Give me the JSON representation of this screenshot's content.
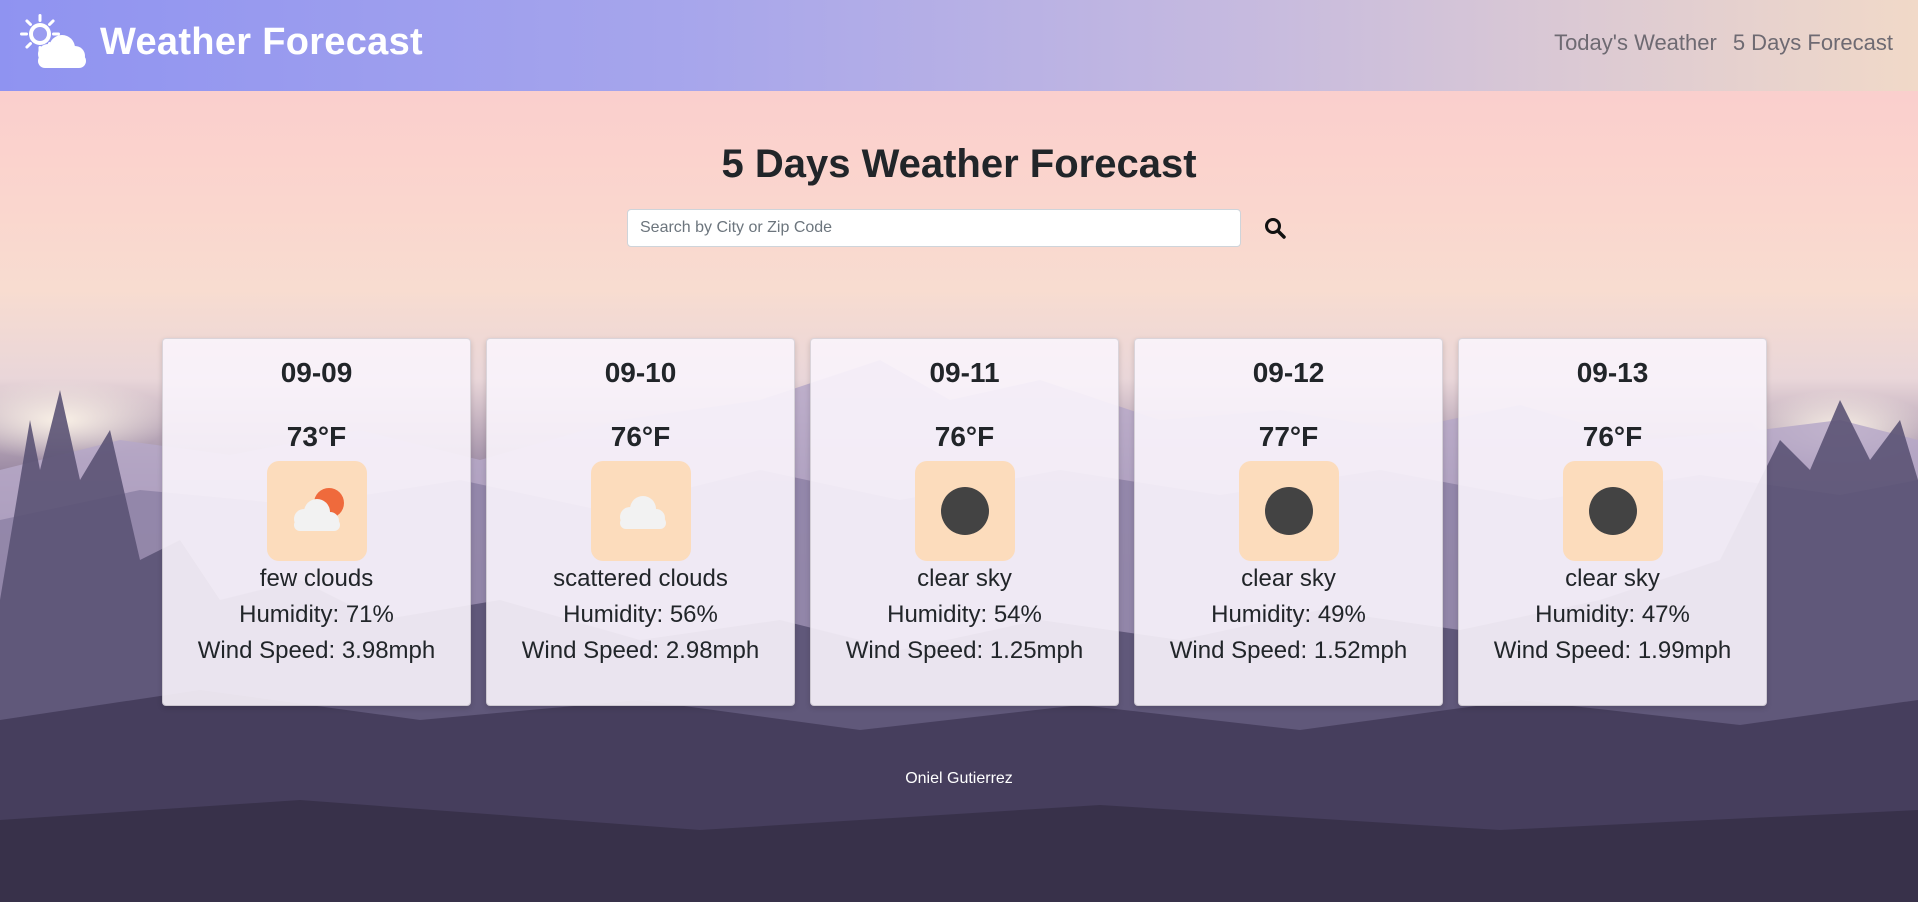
{
  "header": {
    "brand_title": "Weather Forecast",
    "brand_icon": "sun-cloud-icon",
    "nav": [
      {
        "label": "Today's Weather"
      },
      {
        "label": "5 Days Forecast"
      }
    ]
  },
  "main": {
    "title": "5 Days Weather Forecast",
    "search": {
      "placeholder": "Search by City or Zip Code",
      "value": "",
      "button_icon": "search-icon"
    },
    "forecast": [
      {
        "date": "09-09",
        "temp": "73°F",
        "icon": "few-clouds-icon",
        "description": "few clouds",
        "humidity": "Humidity: 71%",
        "wind": "Wind Speed: 3.98mph"
      },
      {
        "date": "09-10",
        "temp": "76°F",
        "icon": "scattered-clouds-icon",
        "description": "scattered clouds",
        "humidity": "Humidity: 56%",
        "wind": "Wind Speed: 2.98mph"
      },
      {
        "date": "09-11",
        "temp": "76°F",
        "icon": "clear-sky-icon",
        "description": "clear sky",
        "humidity": "Humidity: 54%",
        "wind": "Wind Speed: 1.25mph"
      },
      {
        "date": "09-12",
        "temp": "77°F",
        "icon": "clear-sky-icon",
        "description": "clear sky",
        "humidity": "Humidity: 49%",
        "wind": "Wind Speed: 1.52mph"
      },
      {
        "date": "09-13",
        "temp": "76°F",
        "icon": "clear-sky-icon",
        "description": "clear sky",
        "humidity": "Humidity: 47%",
        "wind": "Wind Speed: 1.99mph"
      }
    ]
  },
  "footer": {
    "author": "Oniel Gutierrez"
  },
  "colors": {
    "nav_gradient_start": "#8f93f1",
    "nav_gradient_end": "#f1d9c8",
    "icon_tile": "#fcdcbc",
    "cloud": "#f2f2f2",
    "sun": "#ef6a3c",
    "clear_sky_dot": "#434343"
  }
}
